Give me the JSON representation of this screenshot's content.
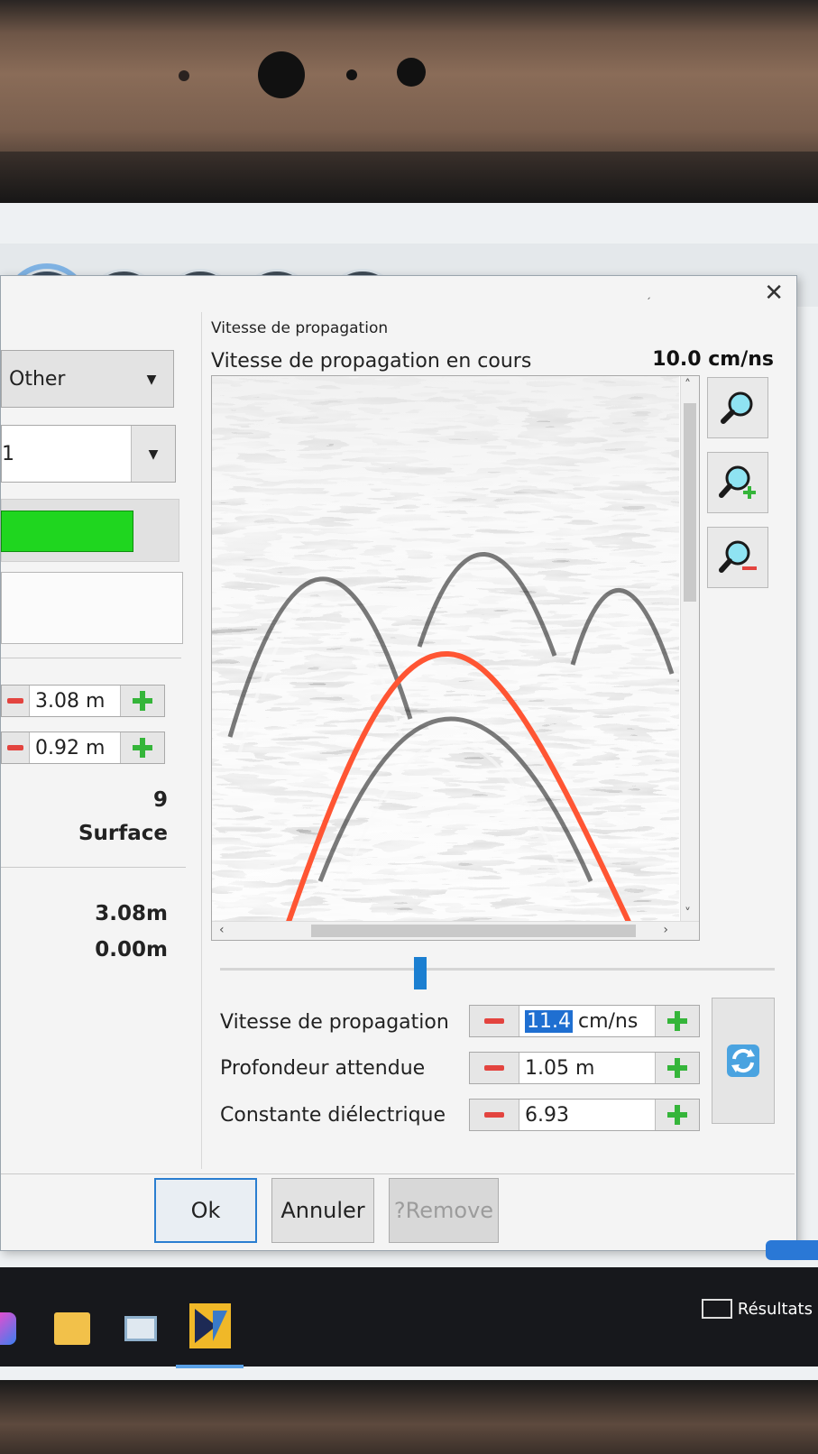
{
  "dialog": {
    "section_title": "Vitesse de propagation",
    "current_velocity_label": "Vitesse de propagation en cours",
    "current_velocity_value": "10.0 cm/ns",
    "close_icon": "close-icon"
  },
  "left": {
    "type_select": "Other",
    "number_select": "1",
    "distance_1": "3.08 m",
    "distance_2": "0.92 m",
    "count": "9",
    "reference": "Surface",
    "value_a": "3.08m",
    "value_b": "0.00m",
    "progress_fraction": 1.0
  },
  "params": [
    {
      "label": "Vitesse de propagation",
      "value": "11.4",
      "unit": "cm/ns"
    },
    {
      "label": "Profondeur attendue",
      "value": "1.05 m",
      "unit": ""
    },
    {
      "label": "Constante diélectrique",
      "value": "6.93",
      "unit": ""
    }
  ],
  "buttons": {
    "ok": "Ok",
    "cancel": "Annuler",
    "remove": "?Remove"
  },
  "taskbar": {
    "results_label": "Résultats"
  },
  "icons": [
    "zoom-icon",
    "zoom-in-icon",
    "zoom-out-icon",
    "refresh-icon"
  ],
  "colors": {
    "hyperbola": "#ff5533",
    "progress": "#1fd61f",
    "selection": "#1f6fd1"
  }
}
